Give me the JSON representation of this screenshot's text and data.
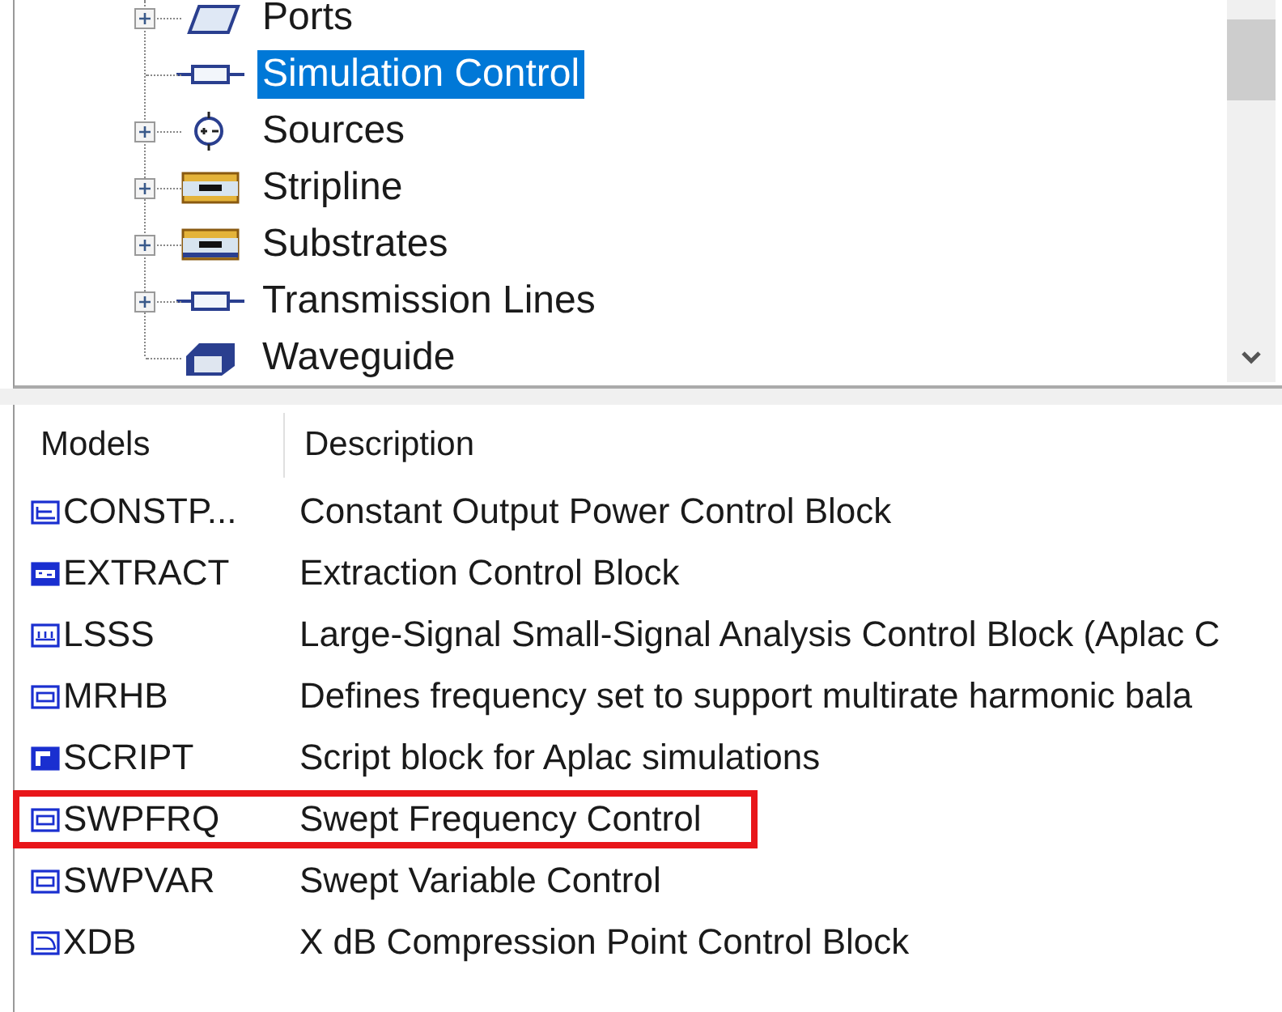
{
  "tree": {
    "items": [
      {
        "label": "Ports",
        "expandable": true,
        "selected": false
      },
      {
        "label": "Simulation Control",
        "expandable": false,
        "selected": true
      },
      {
        "label": "Sources",
        "expandable": true,
        "selected": false
      },
      {
        "label": "Stripline",
        "expandable": true,
        "selected": false
      },
      {
        "label": "Substrates",
        "expandable": true,
        "selected": false
      },
      {
        "label": "Transmission Lines",
        "expandable": true,
        "selected": false
      },
      {
        "label": "Waveguide",
        "expandable": false,
        "selected": false
      }
    ]
  },
  "table": {
    "columns": [
      "Models",
      "Description"
    ],
    "rows": [
      {
        "model": "CONSTP...",
        "description": "Constant Output Power Control Block",
        "highlighted": false
      },
      {
        "model": "EXTRACT",
        "description": "Extraction Control Block",
        "highlighted": false
      },
      {
        "model": "LSSS",
        "description": "Large-Signal Small-Signal Analysis Control Block (Aplac C",
        "highlighted": false
      },
      {
        "model": "MRHB",
        "description": "Defines frequency set to support multirate harmonic bala",
        "highlighted": false
      },
      {
        "model": "SCRIPT",
        "description": "Script block for Aplac simulations",
        "highlighted": false
      },
      {
        "model": "SWPFRQ",
        "description": "Swept Frequency Control",
        "highlighted": true
      },
      {
        "model": "SWPVAR",
        "description": "Swept Variable Control",
        "highlighted": false
      },
      {
        "model": "XDB",
        "description": "X dB Compression Point Control Block",
        "highlighted": false
      }
    ]
  }
}
